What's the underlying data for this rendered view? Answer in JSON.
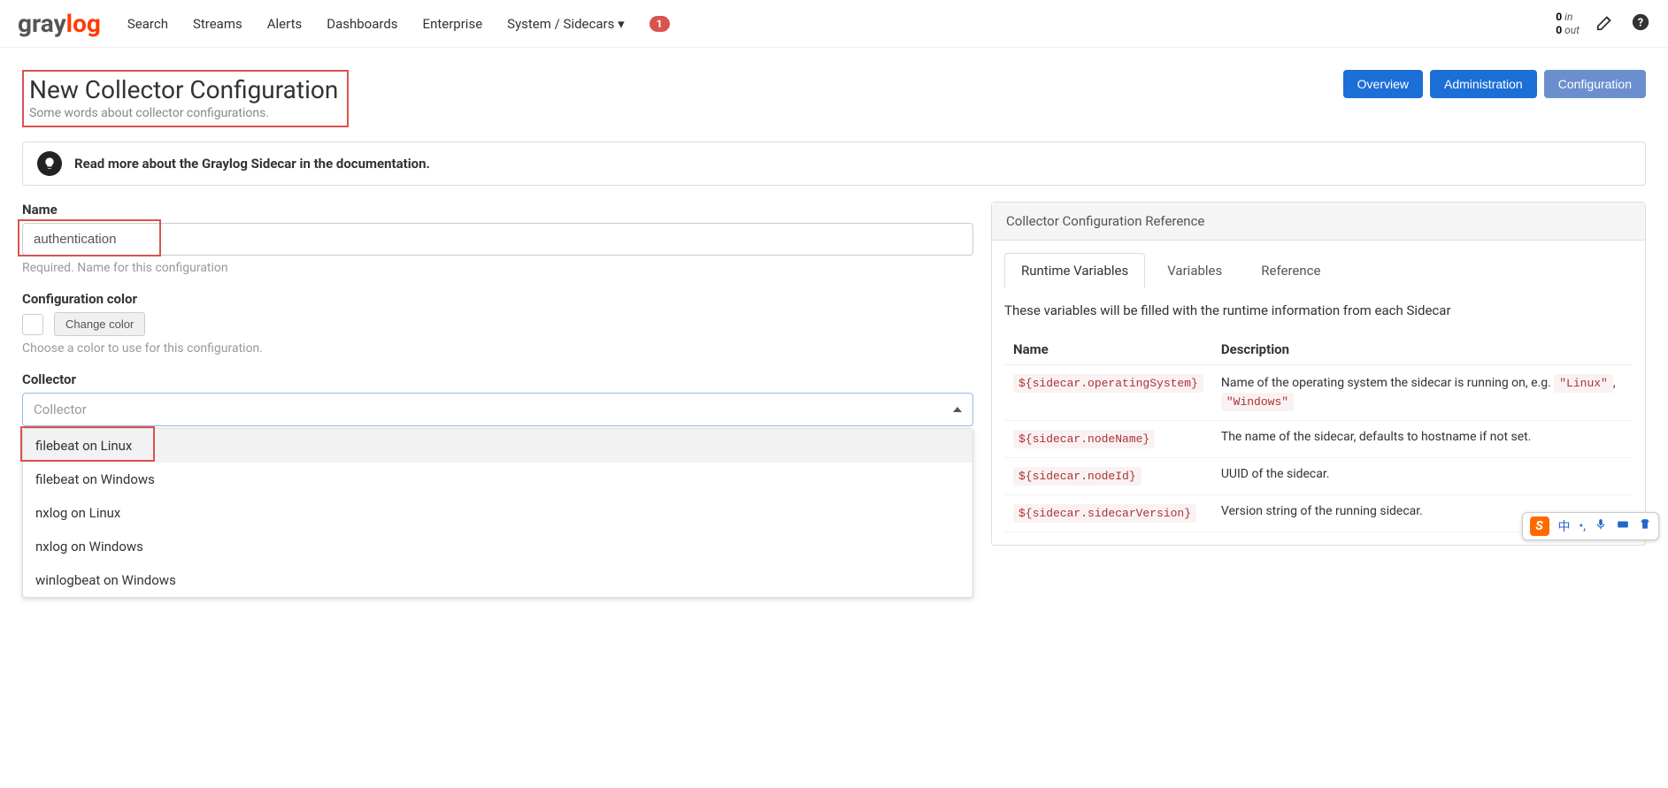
{
  "nav": {
    "items": [
      "Search",
      "Streams",
      "Alerts",
      "Dashboards",
      "Enterprise",
      "System / Sidecars"
    ],
    "badge": "1",
    "io_in_n": "0",
    "io_in_l": "in",
    "io_out_n": "0",
    "io_out_l": "out"
  },
  "header": {
    "title": "New Collector Configuration",
    "subtitle": "Some words about collector configurations.",
    "buttons": {
      "overview": "Overview",
      "admin": "Administration",
      "config": "Configuration"
    }
  },
  "info": "Read more about the Graylog Sidecar in the documentation.",
  "form": {
    "name_label": "Name",
    "name_value": "authentication",
    "name_help": "Required. Name for this configuration",
    "color_label": "Configuration color",
    "change_color": "Change color",
    "color_help": "Choose a color to use for this configuration.",
    "collector_label": "Collector",
    "collector_placeholder": "Collector",
    "options": [
      "filebeat on Linux",
      "filebeat on Windows",
      "nxlog on Linux",
      "nxlog on Windows",
      "winlogbeat on Windows"
    ]
  },
  "ref": {
    "panel_title": "Collector Configuration Reference",
    "tabs": {
      "rt": "Runtime Variables",
      "vars": "Variables",
      "ref": "Reference"
    },
    "desc": "These variables will be filled with the runtime information from each Sidecar",
    "col_name": "Name",
    "col_desc": "Description",
    "rows": [
      {
        "name": "${sidecar.operatingSystem}",
        "desc_pre": "Name of the operating system the sidecar is running on, e.g. ",
        "c1": "\"Linux\"",
        "sep": ", ",
        "c2": "\"Windows\""
      },
      {
        "name": "${sidecar.nodeName}",
        "desc": "The name of the sidecar, defaults to hostname if not set."
      },
      {
        "name": "${sidecar.nodeId}",
        "desc": "UUID of the sidecar."
      },
      {
        "name": "${sidecar.sidecarVersion}",
        "desc": "Version string of the running sidecar."
      }
    ]
  },
  "ime": {
    "ch": "中"
  }
}
